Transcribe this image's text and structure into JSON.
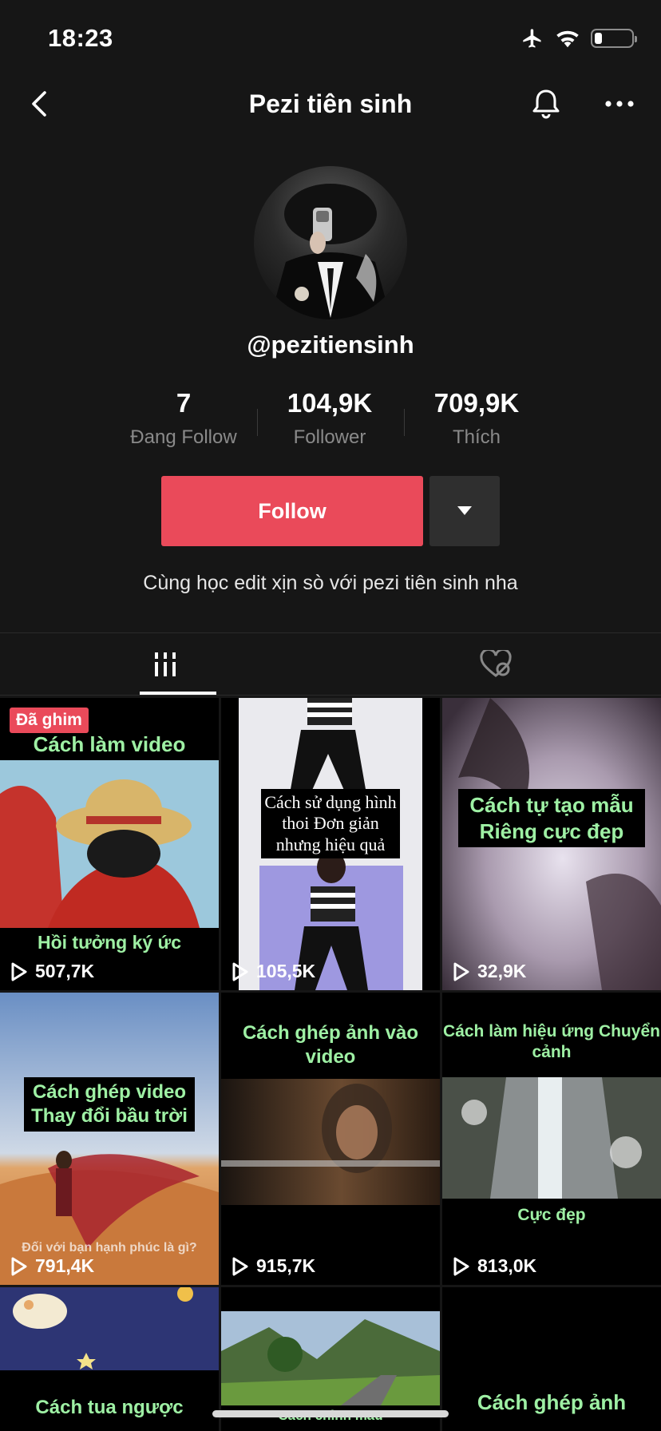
{
  "status_bar": {
    "time": "18:23",
    "battery_level": 0.2
  },
  "header": {
    "title": "Pezi tiên sinh"
  },
  "profile": {
    "username": "@pezitiensinh",
    "bio": "Cùng học edit xịn sò với pezi tiên sinh nha",
    "stats": [
      {
        "value": "7",
        "label": "Đang Follow"
      },
      {
        "value": "104,9K",
        "label": "Follower"
      },
      {
        "value": "709,9K",
        "label": "Thích"
      }
    ],
    "follow_label": "Follow"
  },
  "tabs": [
    {
      "icon": "grid-icon",
      "active": true
    },
    {
      "icon": "liked-hidden-icon",
      "active": false
    }
  ],
  "videos": [
    {
      "badge": "Đã ghim",
      "caption_top": "Cách làm video",
      "caption_bottom": "Hồi tưởng ký ức",
      "views": "507,7K"
    },
    {
      "caption_mid": "Cách sử dụng hình thoi Đơn giản nhưng hiệu quả",
      "views": "105,5K"
    },
    {
      "caption_mid": "Cách tự tạo mẫu Riêng cực đẹp",
      "views": "32,9K"
    },
    {
      "caption_mid": "Cách ghép video Thay đổi bầu trời",
      "caption_bottom": "Đối với bạn hạnh phúc là gì?",
      "views": "791,4K"
    },
    {
      "caption_top": "Cách ghép ảnh vào video",
      "views": "915,7K"
    },
    {
      "caption_top": "Cách làm hiệu ứng Chuyển cảnh",
      "caption_bottom": "Cực đẹp",
      "views": "813,0K"
    },
    {
      "caption_bottom": "Cách tua ngược"
    },
    {
      "caption_bottom": "Cách chỉnh màu"
    },
    {
      "caption_bottom": "Cách ghép ảnh"
    }
  ]
}
